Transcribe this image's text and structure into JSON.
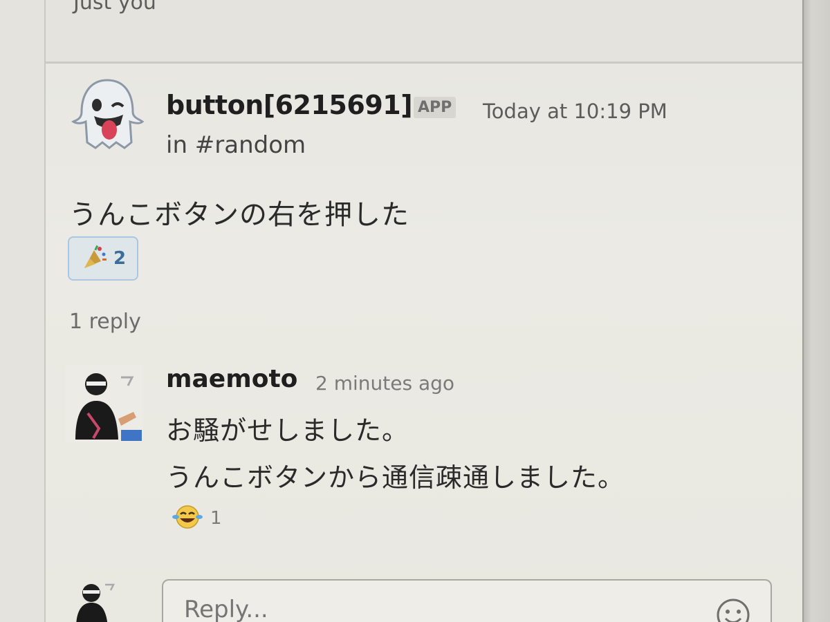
{
  "thread_header": {
    "visibility_note": "Just you"
  },
  "parent_message": {
    "author": "button[6215691]",
    "badge": "APP",
    "timestamp": "Today at 10:19 PM",
    "channel": "in #random",
    "text": "うんこボタンの右を押した",
    "reaction": {
      "emoji": "party-popper",
      "count": "2"
    },
    "avatar_icon": "ghost-emoji-icon"
  },
  "thread_summary": {
    "reply_count": "1 reply"
  },
  "reply_message": {
    "author": "maemoto",
    "timestamp": "2 minutes ago",
    "lines": [
      "お騒がせしました。",
      "うんこボタンから通信疎通しました。"
    ],
    "reaction": {
      "emoji": "joy",
      "count": "1"
    }
  },
  "composer": {
    "placeholder": "Reply..."
  },
  "colors": {
    "background": "#e9e8e1",
    "reaction_border": "#a9c7e0",
    "reaction_count": "#3a6d9a"
  }
}
